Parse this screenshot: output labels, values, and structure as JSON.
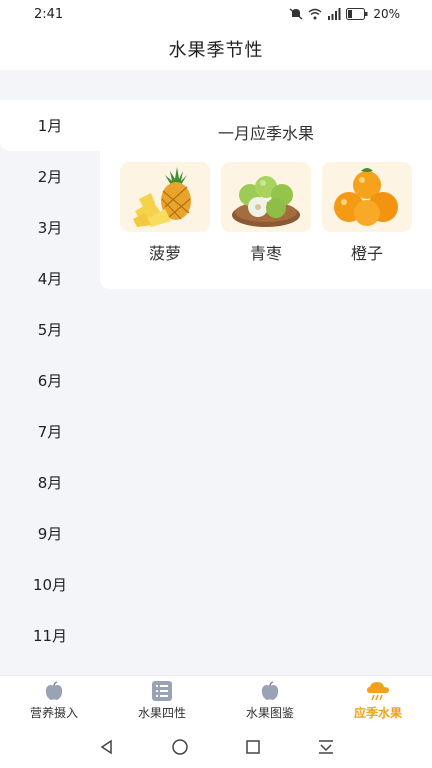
{
  "status_bar": {
    "time": "2:41",
    "battery": "20%",
    "network": "4G"
  },
  "header": {
    "title": "水果季节性"
  },
  "months": [
    "1月",
    "2月",
    "3月",
    "4月",
    "5月",
    "6月",
    "7月",
    "8月",
    "9月",
    "10月",
    "11月"
  ],
  "selected_month_index": 0,
  "content": {
    "title": "一月应季水果",
    "fruits": [
      {
        "name": "菠萝",
        "icon": "pineapple-image"
      },
      {
        "name": "青枣",
        "icon": "jujube-image"
      },
      {
        "name": "橙子",
        "icon": "orange-image"
      }
    ]
  },
  "tabs": [
    {
      "label": "营养摄入",
      "icon": "apple-icon",
      "active": false
    },
    {
      "label": "水果四性",
      "icon": "list-icon",
      "active": false
    },
    {
      "label": "水果图鉴",
      "icon": "apple-icon",
      "active": false
    },
    {
      "label": "应季水果",
      "icon": "weather-icon",
      "active": true
    }
  ],
  "colors": {
    "accent": "#f0a21a",
    "background": "#f4f5f9",
    "card": "#fdf4e3"
  }
}
